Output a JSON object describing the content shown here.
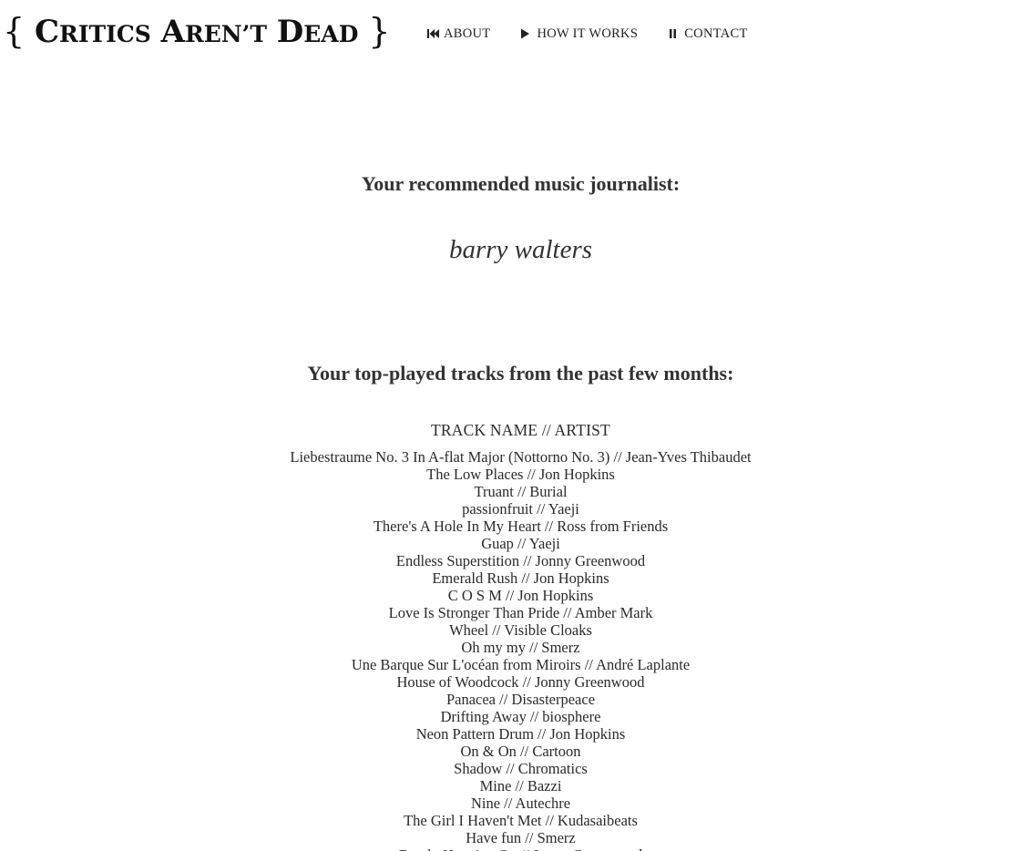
{
  "header": {
    "logo": {
      "open_brace": "{",
      "word1_initial": "C",
      "word1_rest": "RITICS",
      "word2_initial": "A",
      "word2_rest": "REN’T",
      "word3_initial": "D",
      "word3_rest": "EAD",
      "close_brace": "}"
    },
    "nav": [
      {
        "label": "ABOUT",
        "icon": "rewind-icon"
      },
      {
        "label": "HOW IT WORKS",
        "icon": "play-icon"
      },
      {
        "label": "CONTACT",
        "icon": "pause-icon"
      }
    ]
  },
  "recommendation": {
    "heading": "Your recommended music journalist:",
    "journalist": "barry walters"
  },
  "tracks": {
    "heading": "Your top-played tracks from the past few months:",
    "column_header": "TRACK NAME // ARTIST",
    "items": [
      "Liebestraume No. 3 In A-flat Major (Nottorno No. 3) // Jean-Yves Thibaudet",
      "The Low Places // Jon Hopkins",
      "Truant // Burial",
      "passionfruit // Yaeji",
      "There's A Hole In My Heart // Ross from Friends",
      "Guap // Yaeji",
      "Endless Superstition // Jonny Greenwood",
      "Emerald Rush // Jon Hopkins",
      "C O S M // Jon Hopkins",
      "Love Is Stronger Than Pride // Amber Mark",
      "Wheel // Visible Cloaks",
      "Oh my my // Smerz",
      "Une Barque Sur L'océan from Miroirs // André Laplante",
      "House of Woodcock // Jonny Greenwood",
      "Panacea // Disasterpeace",
      "Drifting Away // biosphere",
      "Neon Pattern Drum // Jon Hopkins",
      "On & On // Cartoon",
      "Shadow // Chromatics",
      "Mine // Bazzi",
      "Nine // Autechre",
      "The Girl I Haven't Met // Kudasaibeats",
      "Have fun // Smerz",
      "Barely Hanging On // Jonny Greenwood"
    ]
  },
  "colors": {
    "text": "#2b2b2b",
    "logo": "#111111",
    "background": "#ffffff"
  }
}
